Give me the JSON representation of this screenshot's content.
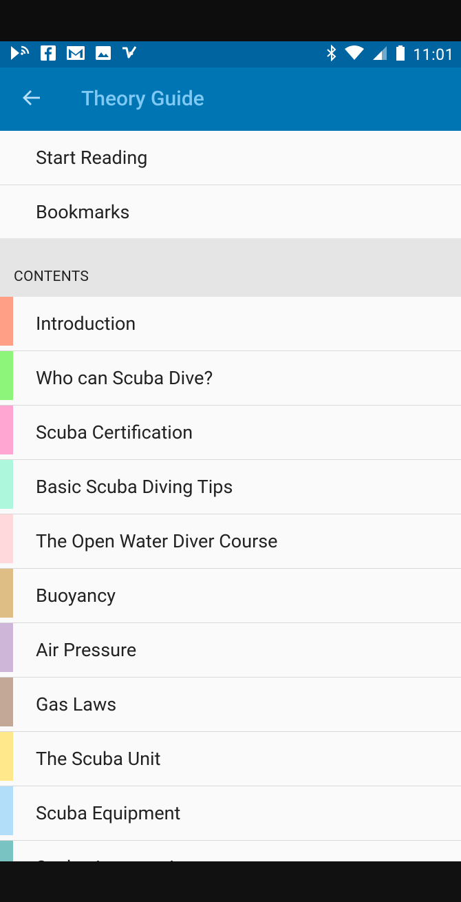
{
  "statusbar": {
    "time": "11:01",
    "left_icons": [
      "cast-icon",
      "facebook-icon",
      "gmail-icon",
      "image-icon",
      "inbox-check-icon"
    ],
    "right_icons": [
      "bluetooth-icon",
      "wifi-icon",
      "signal-icon",
      "battery-icon"
    ]
  },
  "appbar": {
    "title": "Theory Guide",
    "back_icon": "arrow-left-icon"
  },
  "menu": [
    {
      "label": "Start Reading"
    },
    {
      "label": "Bookmarks"
    }
  ],
  "contents": {
    "header": "CONTENTS",
    "items": [
      {
        "label": "Introduction",
        "color": "#ff9f85"
      },
      {
        "label": "Who can Scuba Dive?",
        "color": "#8cf57a"
      },
      {
        "label": "Scuba Certification",
        "color": "#ffa6d3"
      },
      {
        "label": "Basic Scuba Diving Tips",
        "color": "#adf7dc"
      },
      {
        "label": "The Open Water Diver Course",
        "color": "#ffd9dc"
      },
      {
        "label": "Buoyancy",
        "color": "#debe85"
      },
      {
        "label": "Air Pressure",
        "color": "#cdb6d7"
      },
      {
        "label": "Gas Laws",
        "color": "#c3a898"
      },
      {
        "label": "The Scuba Unit",
        "color": "#ffe88c"
      },
      {
        "label": "Scuba Equipment",
        "color": "#b3def9"
      },
      {
        "label": "Scuba Accessories",
        "color": "#79c3c3"
      }
    ]
  },
  "colors": {
    "statusbar": "#0064a0",
    "appbar": "#0075b4",
    "title_text": "#7fc9f5"
  }
}
